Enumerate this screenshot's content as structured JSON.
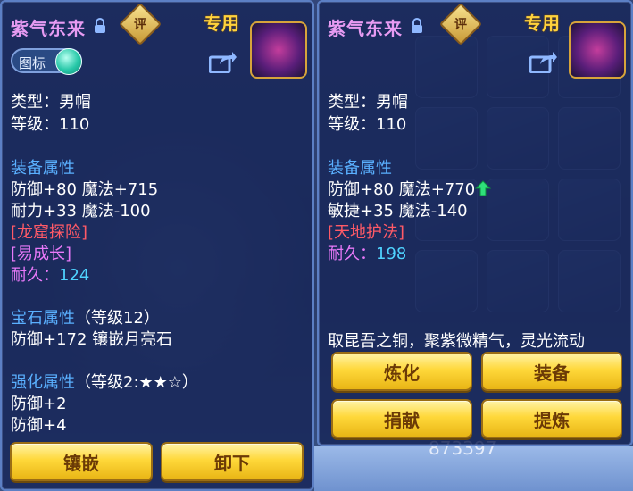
{
  "background": {
    "bottom_number": "873397"
  },
  "left_panel": {
    "title": "紫气东来",
    "eval_badge": "评",
    "special_tag": "专用",
    "toggle_label": "图标",
    "type_line": "类型：男帽",
    "level_line": "等级：110",
    "equip_section": "装备属性",
    "attr_line1": "防御+80 魔法+715",
    "attr_line2": "耐力+33 魔法-100",
    "special_red": "[龙窟探险]",
    "special_purple": "[易成长]",
    "durability_label": "耐久：",
    "durability_value": "124",
    "gem_section": "宝石属性",
    "gem_level": "（等级12）",
    "gem_line": "防御+172 镶嵌月亮石",
    "enhance_section": "强化属性",
    "enhance_level": "（等级2:★★☆）",
    "enhance_line1": "防御+2",
    "enhance_line2": "防御+4",
    "btn_inlay": "镶嵌",
    "btn_unequip": "卸下"
  },
  "right_panel": {
    "title": "紫气东来",
    "eval_badge": "评",
    "special_tag": "专用",
    "type_line": "类型：男帽",
    "level_line": "等级：110",
    "equip_section": "装备属性",
    "attr_line1": "防御+80 魔法+770",
    "attr_line2": "敏捷+35 魔法-140",
    "special_red": "[天地护法]",
    "durability_label": "耐久：",
    "durability_value": "198",
    "description": "取昆吾之铜，聚紫微精气，灵光流动",
    "btn_refine": "炼化",
    "btn_equip": "装备",
    "btn_donate": "捐献",
    "btn_extract": "提炼"
  },
  "colors": {
    "title": "#e79bf2",
    "section": "#5ab0ff",
    "special_red": "#ff5a67",
    "special_purple": "#e879f9",
    "durability": "#4fd3ff",
    "special_tag": "#ffd23c",
    "button_gold": "#ffd83a"
  }
}
